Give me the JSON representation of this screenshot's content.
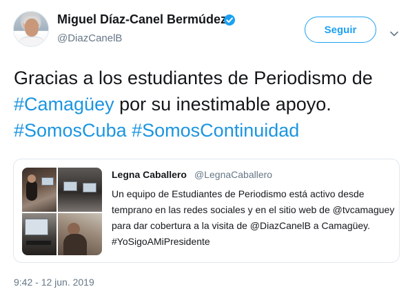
{
  "header": {
    "name": "Miguel Díaz-Canel Bermúdez",
    "handle": "@DiazCanelB",
    "follow_label": "Seguir"
  },
  "icons": {
    "verified": "verified-badge-icon",
    "menu": "chevron-down-icon",
    "avatar": "profile-photo"
  },
  "tweet": {
    "text_plain_1": "Gracias a los estudiantes de Periodismo de",
    "hashtag_1": "#Camagüey",
    "text_plain_2": " por su inestimable apoyo.",
    "hashtag_2": "#SomosCuba",
    "hashtag_3": "#SomosContinuidad"
  },
  "quote": {
    "author_name": "Legna Caballero",
    "author_handle": "@LegnaCaballero",
    "lines": [
      "Un equipo de Estudiantes de Periodismo está activo desde",
      "temprano en las redes sociales y en el sitio web de @tvcamaguey",
      "para dar cobertura a la visita de @DiazCanelB a Camagüey.",
      " #YoSigoAMiPresidente"
    ]
  },
  "timestamp": "9:42 - 12 jun. 2019",
  "colors": {
    "accent": "#1da1f2",
    "hashtag": "#1b95e0",
    "secondary_text": "#657786",
    "border": "#e1e8ed"
  }
}
